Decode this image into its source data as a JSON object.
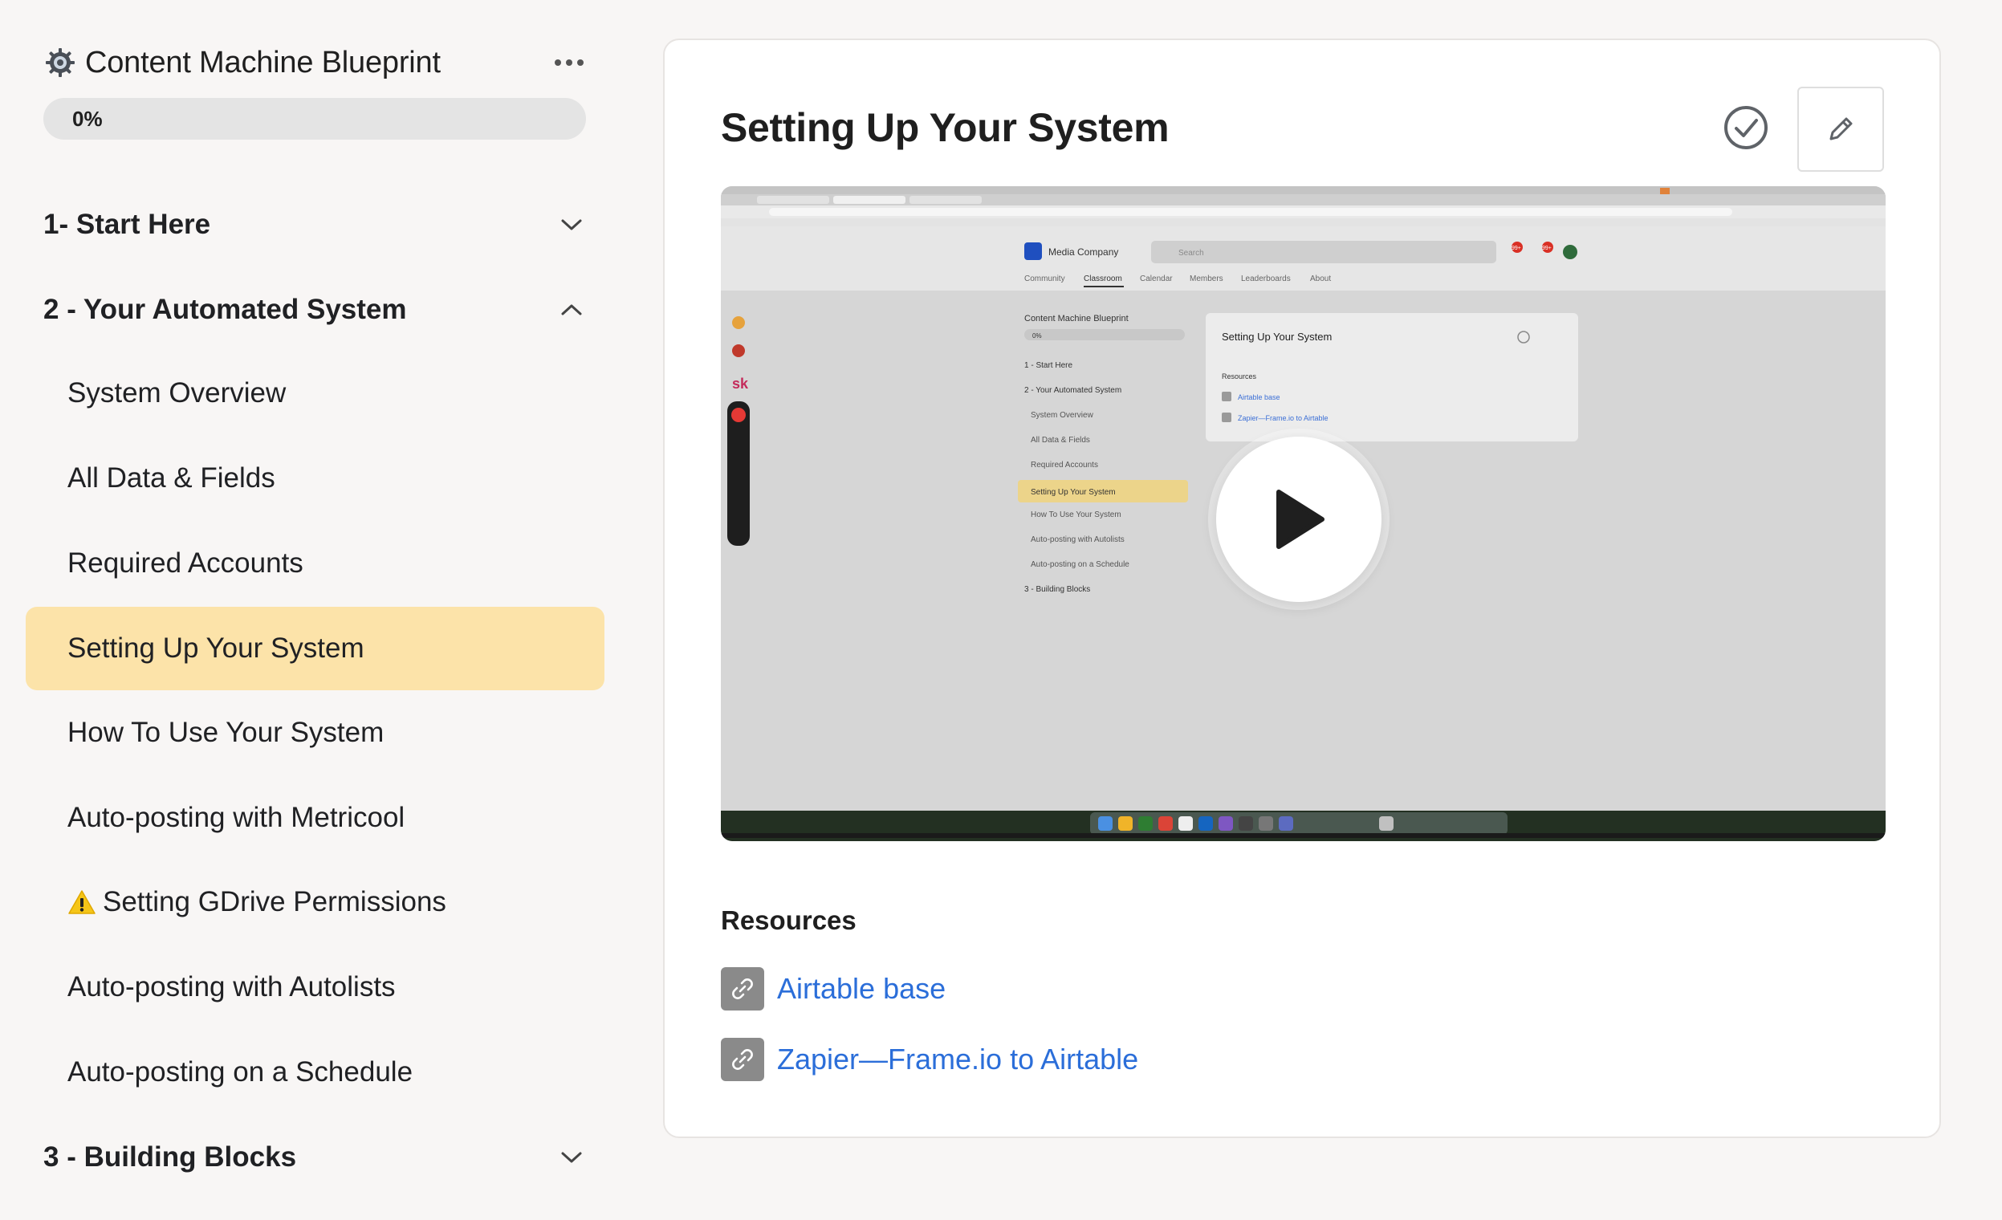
{
  "sidebar": {
    "course_title": "Content Machine Blueprint",
    "course_icon": "gear-badge-icon",
    "more_icon": "more-horizontal-icon",
    "progress": {
      "label": "0%",
      "value": 0
    },
    "modules": [
      {
        "title": "1- Start Here",
        "state": "collapsed",
        "icon": "chevron-down-icon"
      },
      {
        "title": "2 - Your Automated System",
        "state": "expanded",
        "icon": "chevron-up-icon"
      },
      {
        "title": "3 - Building Blocks",
        "state": "collapsed",
        "icon": "chevron-down-icon"
      }
    ],
    "lessons": [
      {
        "label": "System Overview"
      },
      {
        "label": "All Data & Fields"
      },
      {
        "label": "Required Accounts"
      },
      {
        "label": "Setting Up Your System",
        "active": true
      },
      {
        "label": "How To Use Your System"
      },
      {
        "label": "Auto-posting with Metricool"
      },
      {
        "label": "Setting GDrive Permissions",
        "icon": "warning-icon"
      },
      {
        "label": "Auto-posting with Autolists"
      },
      {
        "label": "Auto-posting on a Schedule"
      }
    ]
  },
  "main": {
    "title": "Setting Up Your System",
    "complete_icon": "check-circle-icon",
    "edit_icon": "pencil-icon",
    "video": {
      "play_icon": "play-icon",
      "thumbnail": {
        "brand": "Media Company",
        "search_placeholder": "Search",
        "tabs": [
          "Community",
          "Classroom",
          "Calendar",
          "Members",
          "Leaderboards",
          "About"
        ],
        "badges": [
          "99+",
          "99+"
        ],
        "side_logo": "sk",
        "course_title": "Content Machine Blueprint",
        "progress": "0%",
        "modules": [
          "1 - Start Here",
          "2 - Your Automated System",
          "3 - Building Blocks"
        ],
        "lessons": [
          "System Overview",
          "All Data & Fields",
          "Required Accounts",
          "Setting Up Your System",
          "How To Use Your System",
          "Auto-posting with Autolists",
          "Auto-posting on a Schedule"
        ],
        "card_title": "Setting Up Your System",
        "resources_label": "Resources",
        "resources": [
          "Airtable base",
          "Zapier—Frame.io to Airtable"
        ]
      }
    },
    "resources_title": "Resources",
    "resources": [
      {
        "label": "Airtable base",
        "icon": "link-icon"
      },
      {
        "label": "Zapier—Frame.io to Airtable",
        "icon": "link-icon"
      }
    ]
  },
  "colors": {
    "page_bg": "#f8f6f5",
    "active_lesson_bg": "#fce3a9",
    "link": "#2b6ed9",
    "link_badge": "#8a8a8a"
  }
}
